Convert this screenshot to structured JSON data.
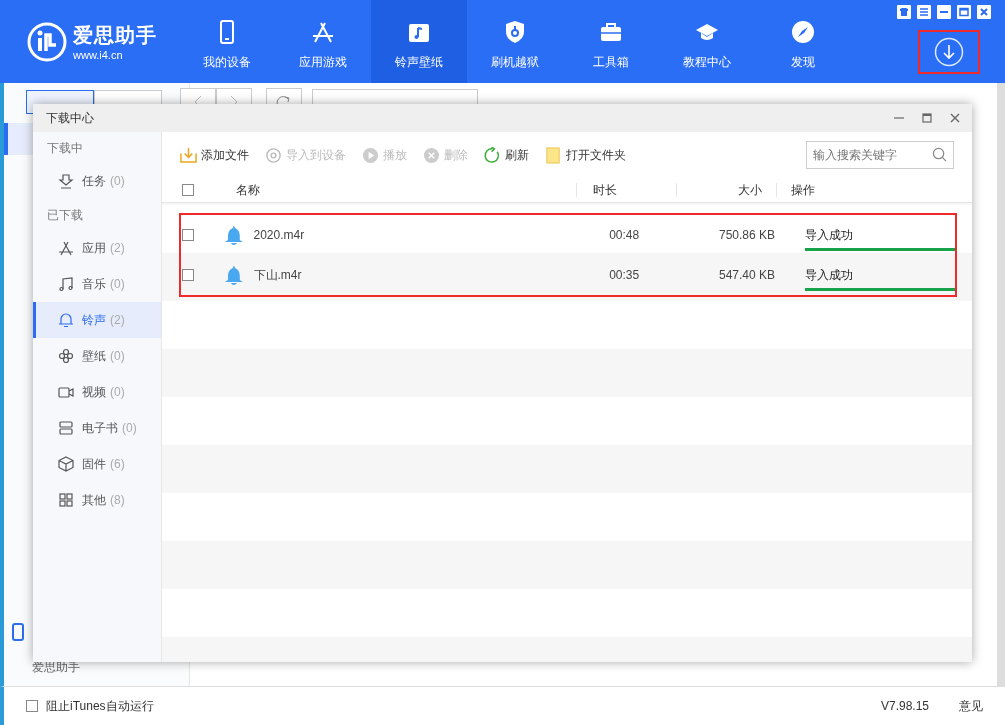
{
  "app": {
    "name": "爱思助手",
    "url": "www.i4.cn"
  },
  "nav": [
    {
      "label": "我的设备",
      "selected": false
    },
    {
      "label": "应用游戏",
      "selected": false
    },
    {
      "label": "铃声壁纸",
      "selected": true
    },
    {
      "label": "刷机越狱",
      "selected": false
    },
    {
      "label": "工具箱",
      "selected": false
    },
    {
      "label": "教程中心",
      "selected": false
    },
    {
      "label": "发现",
      "selected": false
    }
  ],
  "subtabs": [
    {
      "selected": true
    },
    {
      "selected": false
    }
  ],
  "side_label": "爱思助手",
  "status_bar": {
    "itunes": {
      "label": "阻止iTunes自动运行",
      "checked": false
    },
    "version": "V7.98.15",
    "feedback": "意见"
  },
  "dialog": {
    "title": "下载中心",
    "sections": [
      {
        "heading": "下载中",
        "items": [
          {
            "label": "任务",
            "count": "(0)",
            "selected": false
          }
        ]
      },
      {
        "heading": "已下载",
        "items": [
          {
            "label": "应用",
            "count": "(2)",
            "selected": false
          },
          {
            "label": "音乐",
            "count": "(0)",
            "selected": false
          },
          {
            "label": "铃声",
            "count": "(2)",
            "selected": true
          },
          {
            "label": "壁纸",
            "count": "(0)",
            "selected": false
          },
          {
            "label": "视频",
            "count": "(0)",
            "selected": false
          },
          {
            "label": "电子书",
            "count": "(0)",
            "selected": false
          },
          {
            "label": "固件",
            "count": "(6)",
            "selected": false
          },
          {
            "label": "其他",
            "count": "(8)",
            "selected": false
          }
        ]
      }
    ],
    "toolbar": [
      {
        "label": "添加文件",
        "disabled": false
      },
      {
        "label": "导入到设备",
        "disabled": true
      },
      {
        "label": "播放",
        "disabled": true
      },
      {
        "label": "删除",
        "disabled": true
      },
      {
        "label": "刷新",
        "disabled": false
      },
      {
        "label": "打开文件夹",
        "disabled": false
      }
    ],
    "search": {
      "placeholder": "输入搜索关键字"
    },
    "columns": [
      "名称",
      "时长",
      "大小",
      "操作"
    ],
    "select_all": {
      "checked": false
    },
    "rows": [
      {
        "checked": false,
        "name": "2020.m4r",
        "duration": "00:48",
        "size": "750.86 KB",
        "status": "导入成功",
        "level": 1
      },
      {
        "checked": false,
        "name": "下山.m4r",
        "duration": "00:35",
        "size": "547.40 KB",
        "status": "导入成功",
        "level": 1
      }
    ]
  }
}
